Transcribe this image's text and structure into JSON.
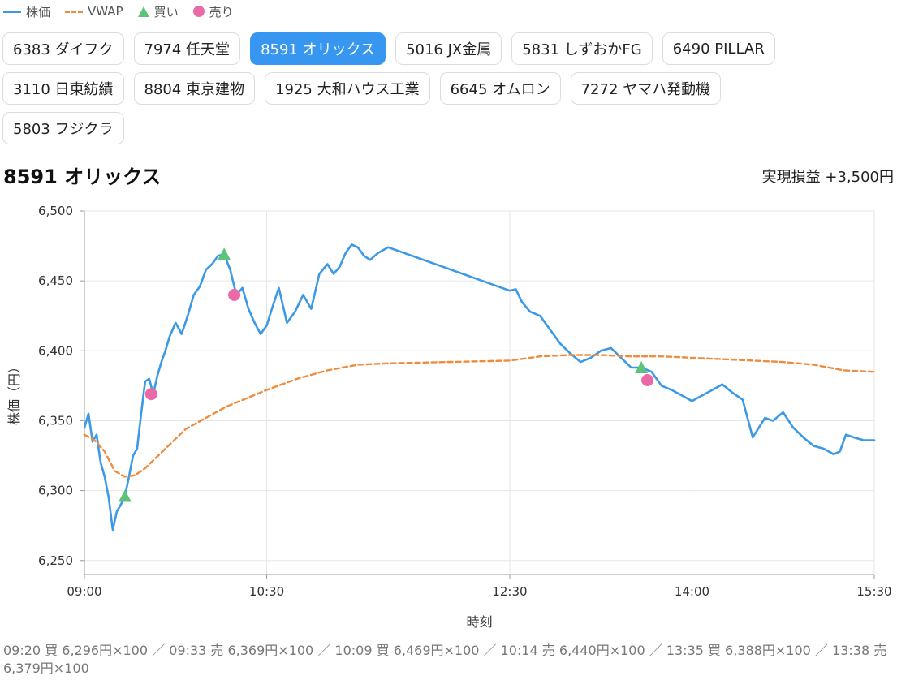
{
  "legend": [
    {
      "label": "株価",
      "kind": "line",
      "color": "#3b99e6"
    },
    {
      "label": "VWAP",
      "kind": "dashed",
      "color": "#ef8b3b"
    },
    {
      "label": "買い",
      "kind": "triangle",
      "color": "#5ec37a"
    },
    {
      "label": "売り",
      "kind": "dot",
      "color": "#e96aa7"
    }
  ],
  "tabs": [
    [
      {
        "label": "6383 ダイフク",
        "active": false
      },
      {
        "label": "7974 任天堂",
        "active": false
      },
      {
        "label": "8591 オリックス",
        "active": true
      },
      {
        "label": "5016 JX金属",
        "active": false
      },
      {
        "label": "5831 しずおかFG",
        "active": false
      },
      {
        "label": "6490 PILLAR",
        "active": false
      }
    ],
    [
      {
        "label": "3110 日東紡績",
        "active": false
      },
      {
        "label": "8804 東京建物",
        "active": false
      },
      {
        "label": "1925 大和ハウス工業",
        "active": false
      },
      {
        "label": "6645 オムロン",
        "active": false
      },
      {
        "label": "7272 ヤマハ発動機",
        "active": false
      }
    ],
    [
      {
        "label": "5803 フジクラ",
        "active": false
      }
    ]
  ],
  "title": "8591 オリックス",
  "realized_pnl": "実現損益 +3,500円",
  "trade_log": "09:20 買 6,296円×100 ／ 09:33 売 6,369円×100 ／ 10:09 買 6,469円×100 ／ 10:14 売 6,440円×100 ／ 13:35 買 6,388円×100 ／ 13:38 売 6,379円×100",
  "colors": {
    "price": "#3b99e6",
    "vwap": "#ef8b3b",
    "buy": "#5ec37a",
    "sell": "#e96aa7",
    "active_tab": "#3797f0"
  },
  "chart_data": {
    "type": "line",
    "xlabel": "時刻",
    "ylabel": "株価（円）",
    "xlim": [
      "09:00",
      "15:30"
    ],
    "ylim": [
      6240,
      6500
    ],
    "x_ticks": [
      "09:00",
      "10:30",
      "12:30",
      "14:00",
      "15:30"
    ],
    "y_ticks": [
      6250,
      6300,
      6350,
      6400,
      6450,
      6500
    ],
    "grid": true,
    "legend_position": "top-left",
    "series": [
      {
        "name": "株価",
        "style": "solid",
        "x": [
          "09:00",
          "09:02",
          "09:04",
          "09:06",
          "09:08",
          "09:10",
          "09:12",
          "09:14",
          "09:16",
          "09:18",
          "09:20",
          "09:22",
          "09:24",
          "09:26",
          "09:28",
          "09:30",
          "09:32",
          "09:34",
          "09:36",
          "09:38",
          "09:40",
          "09:42",
          "09:45",
          "09:48",
          "09:51",
          "09:54",
          "09:57",
          "10:00",
          "10:03",
          "10:06",
          "10:09",
          "10:12",
          "10:15",
          "10:18",
          "10:21",
          "10:24",
          "10:27",
          "10:30",
          "10:33",
          "10:36",
          "10:40",
          "10:44",
          "10:48",
          "10:52",
          "10:56",
          "11:00",
          "11:03",
          "11:06",
          "11:09",
          "11:12",
          "11:15",
          "11:18",
          "11:21",
          "11:25",
          "11:30",
          "12:30",
          "12:33",
          "12:36",
          "12:40",
          "12:45",
          "12:50",
          "12:55",
          "13:00",
          "13:05",
          "13:10",
          "13:15",
          "13:20",
          "13:25",
          "13:30",
          "13:35",
          "13:40",
          "13:45",
          "13:50",
          "13:55",
          "14:00",
          "14:05",
          "14:10",
          "14:15",
          "14:20",
          "14:25",
          "14:30",
          "14:33",
          "14:36",
          "14:40",
          "14:45",
          "14:50",
          "14:55",
          "15:00",
          "15:05",
          "15:10",
          "15:13",
          "15:16",
          "15:20",
          "15:25",
          "15:30"
        ],
        "values": [
          6345,
          6355,
          6335,
          6340,
          6320,
          6310,
          6295,
          6272,
          6285,
          6290,
          6296,
          6310,
          6325,
          6330,
          6355,
          6378,
          6380,
          6369,
          6382,
          6392,
          6400,
          6410,
          6420,
          6412,
          6425,
          6440,
          6446,
          6458,
          6462,
          6468,
          6469,
          6458,
          6440,
          6445,
          6430,
          6420,
          6412,
          6418,
          6432,
          6445,
          6420,
          6428,
          6440,
          6430,
          6455,
          6462,
          6455,
          6460,
          6470,
          6476,
          6474,
          6468,
          6465,
          6470,
          6474,
          6443,
          6444,
          6435,
          6428,
          6425,
          6415,
          6405,
          6398,
          6392,
          6395,
          6400,
          6402,
          6395,
          6388,
          6388,
          6385,
          6375,
          6372,
          6368,
          6364,
          6368,
          6372,
          6376,
          6370,
          6365,
          6338,
          6345,
          6352,
          6350,
          6356,
          6345,
          6338,
          6332,
          6330,
          6326,
          6328,
          6340,
          6338,
          6336,
          6336
        ]
      },
      {
        "name": "VWAP",
        "style": "dashed",
        "x": [
          "09:00",
          "09:05",
          "09:10",
          "09:15",
          "09:20",
          "09:25",
          "09:30",
          "09:40",
          "09:50",
          "10:00",
          "10:10",
          "10:20",
          "10:30",
          "10:45",
          "11:00",
          "11:15",
          "11:30",
          "12:30",
          "12:45",
          "13:00",
          "13:15",
          "13:30",
          "13:45",
          "14:00",
          "14:15",
          "14:30",
          "14:45",
          "15:00",
          "15:15",
          "15:30"
        ],
        "values": [
          6340,
          6336,
          6328,
          6314,
          6310,
          6311,
          6316,
          6330,
          6344,
          6352,
          6360,
          6366,
          6372,
          6380,
          6386,
          6390,
          6391,
          6393,
          6396,
          6397,
          6397,
          6396,
          6396,
          6395,
          6394,
          6393,
          6392,
          6390,
          6386,
          6385
        ]
      }
    ],
    "trades": [
      {
        "time": "09:20",
        "side": "買い",
        "price": 6296
      },
      {
        "time": "09:33",
        "side": "売り",
        "price": 6369
      },
      {
        "time": "10:09",
        "side": "買い",
        "price": 6469
      },
      {
        "time": "10:14",
        "side": "売り",
        "price": 6440
      },
      {
        "time": "13:35",
        "side": "買い",
        "price": 6388
      },
      {
        "time": "13:38",
        "side": "売り",
        "price": 6379
      }
    ]
  }
}
